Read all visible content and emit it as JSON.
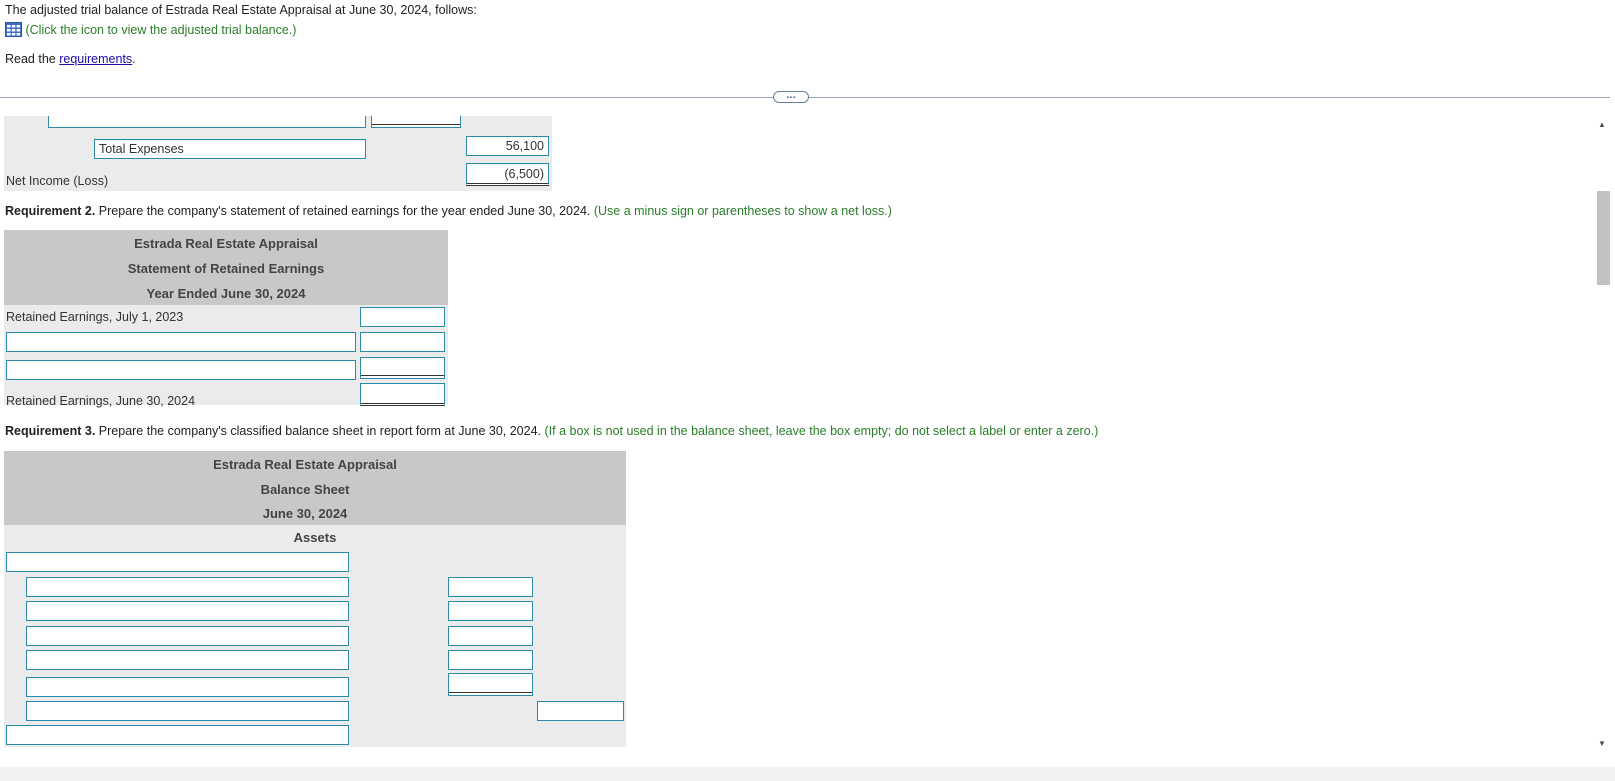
{
  "intro": {
    "line1": "The adjusted trial balance of Estrada Real Estate Appraisal at June 30, 2024, follows:",
    "icon_hint": "(Click the icon to view the adjusted trial balance.)",
    "read_prefix": "Read the ",
    "read_link": "requirements",
    "read_suffix": "."
  },
  "divider_handle": "…",
  "income": {
    "total_expenses_label": "Total Expenses",
    "total_expenses_value": "56,100",
    "net_income_label": "Net Income (Loss)",
    "net_income_value": "(6,500)"
  },
  "req2": {
    "bold": "Requirement 2.",
    "text": " Prepare the company's statement of retained earnings for the year ended June 30, 2024.",
    "hint": " (Use a minus sign or parentheses to show a net loss.)",
    "company": "Estrada Real Estate Appraisal",
    "statement": "Statement of Retained Earnings",
    "period": "Year Ended June 30, 2024",
    "row_begin": "Retained Earnings, July 1, 2023",
    "row_end": "Retained Earnings, June 30, 2024"
  },
  "req3": {
    "bold": "Requirement 3.",
    "text": " Prepare the company's classified balance sheet in report form at June 30, 2024.",
    "hint": " (If a box is not used in the balance sheet, leave the box empty; do not select a label or enter a zero.)",
    "company": "Estrada Real Estate Appraisal",
    "statement": "Balance Sheet",
    "date": "June 30, 2024",
    "section": "Assets"
  },
  "colors": {
    "accent_border": "#2b8aa8",
    "hint_green": "#2a7d2a",
    "panel_bg": "#ebebeb",
    "header_bg": "#c8c8c8"
  },
  "icons": {
    "table": "grid-table-icon",
    "scroll_up": "triangle-up",
    "scroll_down": "triangle-down"
  }
}
